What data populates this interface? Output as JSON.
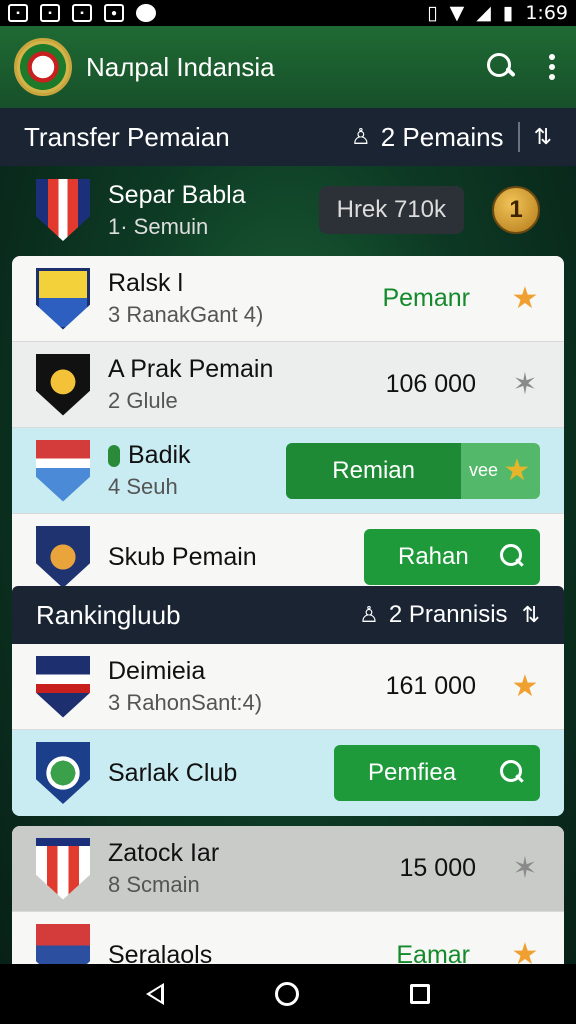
{
  "status_bar": {
    "time": "1:69",
    "left_icons": [
      "notification-icon",
      "image-icon",
      "gallery-icon",
      "camera-icon",
      "sync-icon"
    ],
    "right_icons": [
      "vibrate-icon",
      "wifi-icon",
      "signal-icon",
      "battery-icon"
    ]
  },
  "app_bar": {
    "title": "Naлpal Indansia"
  },
  "transfer_section": {
    "title": "Transfer Pemaian",
    "count": "2",
    "count_label": "Pemains",
    "featured": {
      "name": "Separ Babla",
      "sub": "1· Semuin",
      "price": "Hrek 710k",
      "rank": "1"
    },
    "rows": [
      {
        "name": "Ralsk l",
        "sub": "3  RanakGant 4)",
        "action": "Pemanr"
      },
      {
        "name": "A Prak Pemain",
        "sub": "2  Glule",
        "value": "106 000"
      },
      {
        "name": "Badik",
        "sub": "4  Seuh",
        "button": "Remian",
        "side": "vee"
      },
      {
        "name": "Skub Pemain",
        "button": "Rahan"
      }
    ]
  },
  "ranking_section": {
    "title": "Rankingluub",
    "count": "2",
    "count_label": "Prannisis",
    "rows": [
      {
        "name": "Deimieia",
        "sub": "3  RahonSant:4)",
        "value": "161 000"
      },
      {
        "name": "Sarlak Club",
        "button": "Pemfiea"
      }
    ]
  },
  "third_section": {
    "rows": [
      {
        "name": "Zatock Iar",
        "sub": "8  Scmain",
        "value": "15 000"
      },
      {
        "name": "Seralaols",
        "action": "Eamar"
      }
    ]
  },
  "colors": {
    "app_bar": "#1f6a34",
    "section_header": "#1a2433",
    "accent_green": "#1f9a3b",
    "star": "#f0a030",
    "teal_row": "#c8ecf2"
  }
}
